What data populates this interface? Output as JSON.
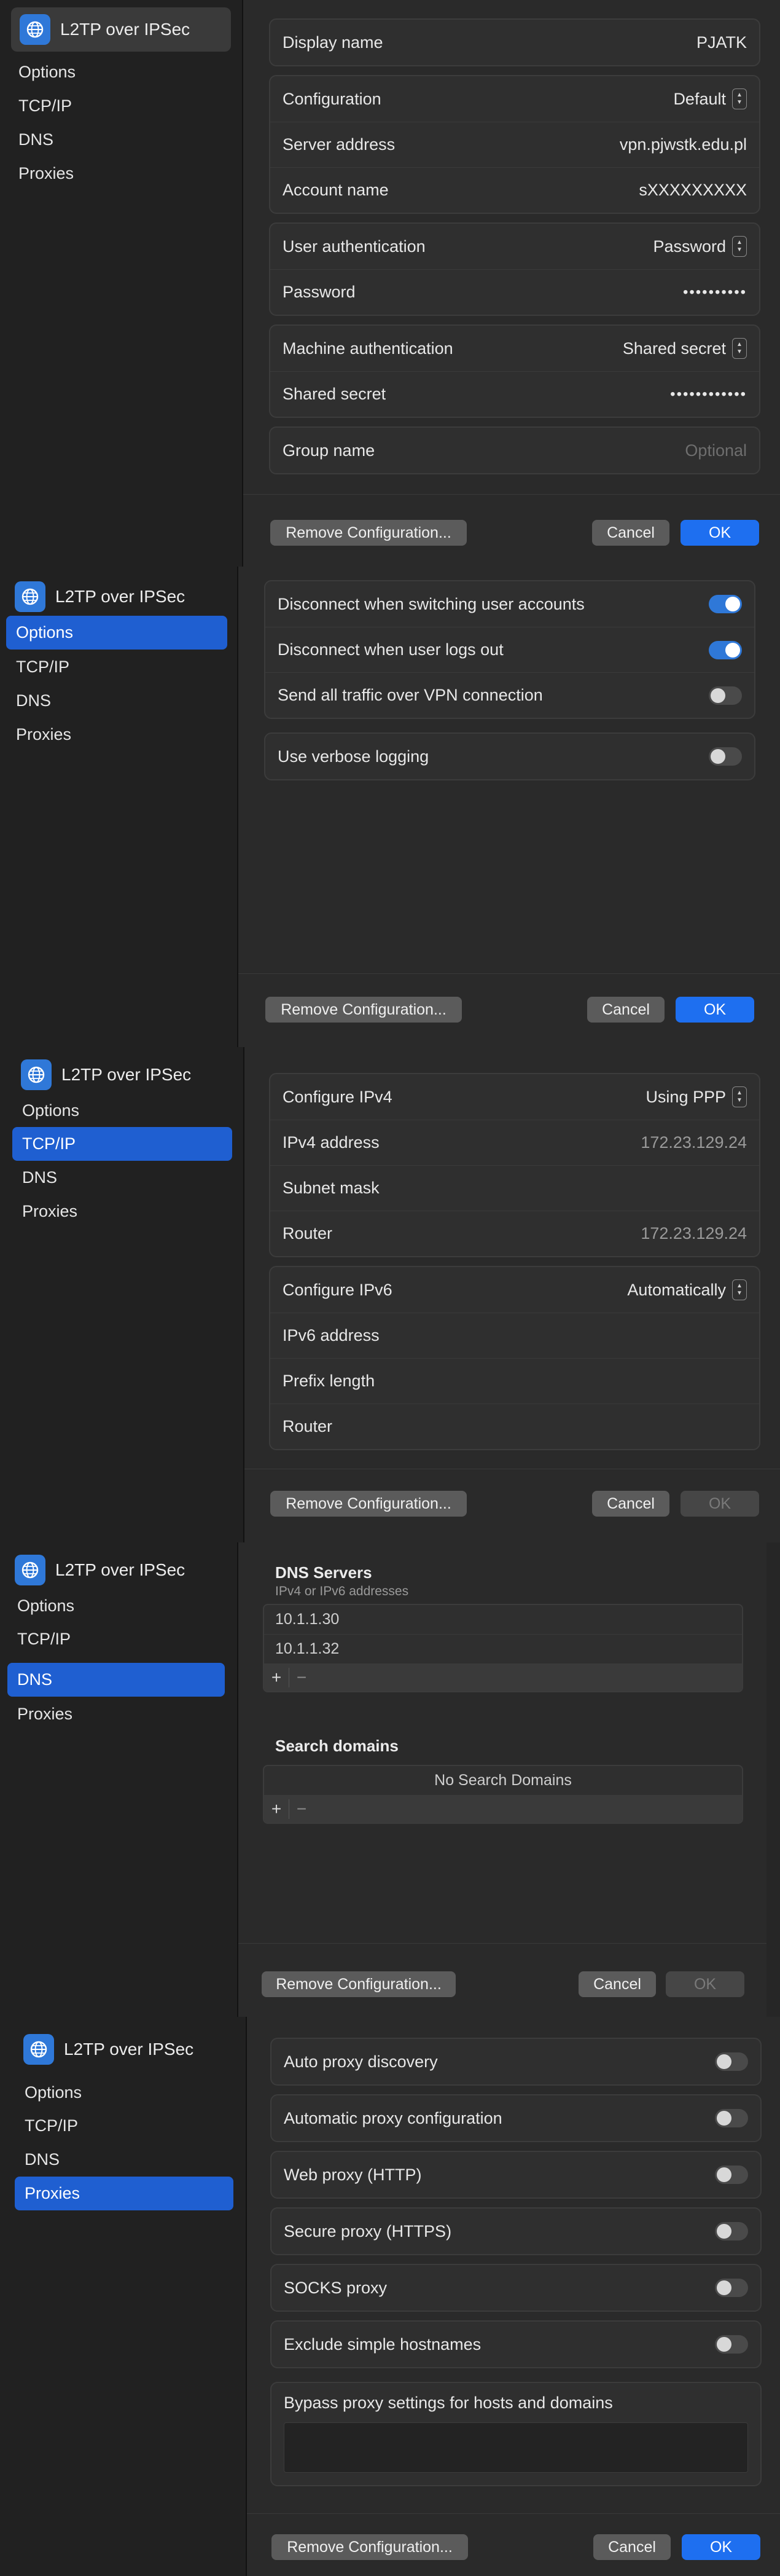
{
  "sidebar": {
    "title": "L2TP over IPSec",
    "items": [
      "Options",
      "TCP/IP",
      "DNS",
      "Proxies"
    ]
  },
  "footer": {
    "remove": "Remove Configuration...",
    "cancel": "Cancel",
    "ok": "OK"
  },
  "config": {
    "display_name_label": "Display name",
    "display_name_value": "PJATK",
    "configuration_label": "Configuration",
    "configuration_value": "Default",
    "server_label": "Server address",
    "server_value": "vpn.pjwstk.edu.pl",
    "account_label": "Account name",
    "account_value": "sXXXXXXXXX",
    "user_auth_label": "User authentication",
    "user_auth_value": "Password",
    "password_label": "Password",
    "password_value": "••••••••••",
    "machine_auth_label": "Machine authentication",
    "machine_auth_value": "Shared secret",
    "shared_secret_label": "Shared secret",
    "shared_secret_value": "••••••••••••",
    "group_label": "Group name",
    "group_placeholder": "Optional"
  },
  "options": {
    "items": [
      {
        "label": "Disconnect when switching user accounts",
        "on": true
      },
      {
        "label": "Disconnect when user logs out",
        "on": true
      },
      {
        "label": "Send all traffic over VPN connection",
        "on": false
      }
    ],
    "verbose": {
      "label": "Use verbose logging",
      "on": false
    }
  },
  "tcpip": {
    "configure_ipv4_label": "Configure IPv4",
    "configure_ipv4_value": "Using PPP",
    "ipv4_address_label": "IPv4 address",
    "ipv4_address_value": "172.23.129.24",
    "subnet_label": "Subnet mask",
    "router_label": "Router",
    "router_value": "172.23.129.24",
    "configure_ipv6_label": "Configure IPv6",
    "configure_ipv6_value": "Automatically",
    "ipv6_address_label": "IPv6 address",
    "prefix_label": "Prefix length",
    "router6_label": "Router"
  },
  "dns": {
    "servers_title": "DNS Servers",
    "servers_subtitle": "IPv4 or IPv6 addresses",
    "servers": [
      "10.1.1.30",
      "10.1.1.32"
    ],
    "search_title": "Search domains",
    "search_empty": "No Search Domains",
    "add": "+",
    "remove": "−"
  },
  "proxies": {
    "items": [
      {
        "label": "Auto proxy discovery",
        "on": false
      },
      {
        "label": "Automatic proxy configuration",
        "on": false
      },
      {
        "label": "Web proxy (HTTP)",
        "on": false
      },
      {
        "label": "Secure proxy (HTTPS)",
        "on": false
      },
      {
        "label": "SOCKS proxy",
        "on": false
      },
      {
        "label": "Exclude simple hostnames",
        "on": false
      }
    ],
    "bypass_label": "Bypass proxy settings for hosts and domains"
  }
}
